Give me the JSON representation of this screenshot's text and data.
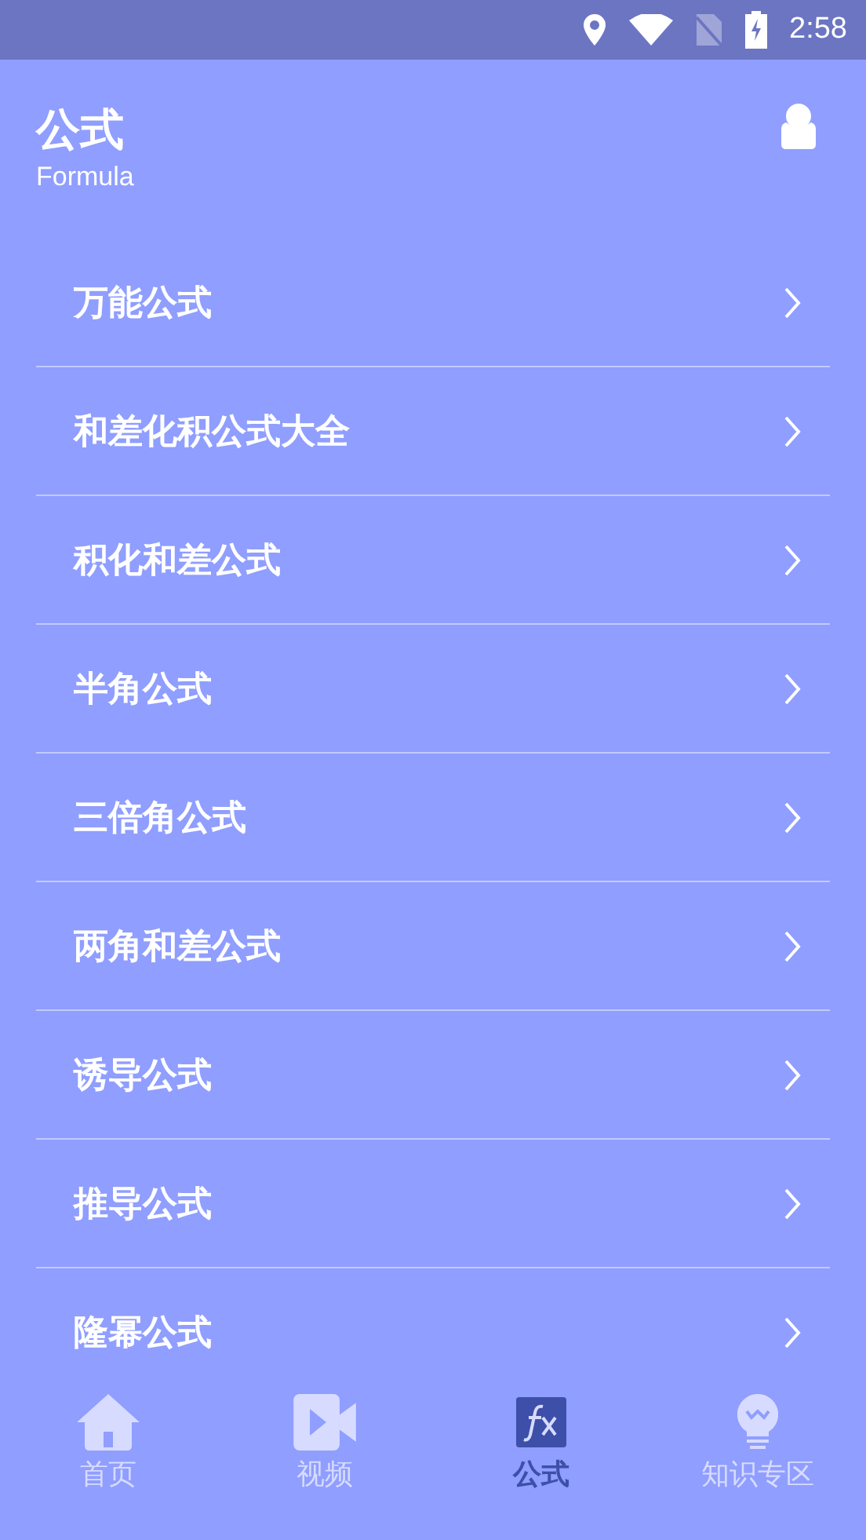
{
  "status_bar": {
    "time": "2:58"
  },
  "header": {
    "title": "公式",
    "subtitle": "Formula"
  },
  "items": [
    {
      "label": "万能公式"
    },
    {
      "label": "和差化积公式大全"
    },
    {
      "label": "积化和差公式"
    },
    {
      "label": "半角公式"
    },
    {
      "label": "三倍角公式"
    },
    {
      "label": "两角和差公式"
    },
    {
      "label": "诱导公式"
    },
    {
      "label": "推导公式"
    },
    {
      "label": "隆幂公式"
    }
  ],
  "tabs": [
    {
      "label": "首页",
      "kind": "home",
      "selected": false
    },
    {
      "label": "视频",
      "kind": "video",
      "selected": false
    },
    {
      "label": "公式",
      "kind": "formula",
      "selected": true
    },
    {
      "label": "知识专区",
      "kind": "knowledge",
      "selected": false
    }
  ]
}
